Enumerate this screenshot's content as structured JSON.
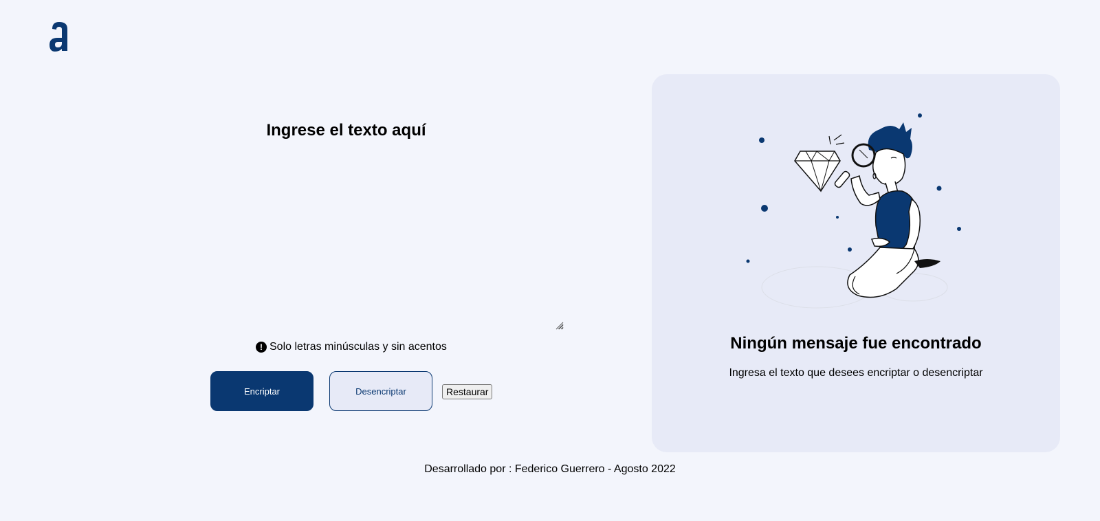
{
  "brand": {
    "logo_letter": "a",
    "primary_color": "#0a3871",
    "background_color": "#f3f5fc",
    "panel_color": "#e7eaf7"
  },
  "input": {
    "title": "Ingrese el texto aquí",
    "value": "",
    "placeholder": "",
    "hint": "Solo letras minúsculas y sin acentos",
    "hint_icon": "exclamation-circle-icon"
  },
  "actions": {
    "encrypt_label": "Encriptar",
    "decrypt_label": "Desencriptar",
    "restore_label": "Restaurar"
  },
  "output": {
    "title": "Ningún mensaje fue encontrado",
    "subtitle": "Ingresa el texto que desees encriptar o desencriptar",
    "illustration": "person-with-magnifying-glass-and-diamond"
  },
  "footer": {
    "text": "Desarrollado por : Federico Guerrero - Agosto 2022"
  }
}
